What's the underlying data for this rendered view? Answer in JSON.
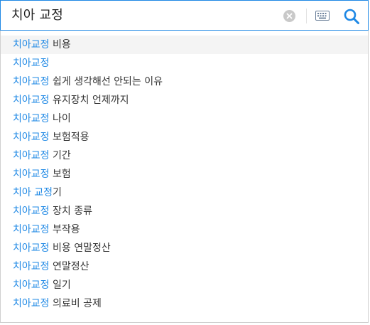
{
  "search": {
    "query": "치아 교정",
    "clear_icon": "clear-circle-icon",
    "keyboard_icon": "keyboard-icon",
    "search_icon": "magnifier-icon"
  },
  "colors": {
    "accent": "#1e88e5",
    "text": "#333333",
    "active_row": "#f4f4f4",
    "clear_button": "#c9c9c9"
  },
  "suggestions": [
    {
      "match": "치아교정",
      "rest": " 비용"
    },
    {
      "match": "치아교정",
      "rest": ""
    },
    {
      "match": "치아교정",
      "rest": " 쉽게 생각해선 안되는 이유"
    },
    {
      "match": "치아교정",
      "rest": " 유지장치 언제까지"
    },
    {
      "match": "치아교정",
      "rest": " 나이"
    },
    {
      "match": "치아교정",
      "rest": " 보험적용"
    },
    {
      "match": "치아교정",
      "rest": " 기간"
    },
    {
      "match": "치아교정",
      "rest": " 보험"
    },
    {
      "match": "치아 교정",
      "rest": "기"
    },
    {
      "match": "치아교정",
      "rest": " 장치 종류"
    },
    {
      "match": "치아교정",
      "rest": " 부작용"
    },
    {
      "match": "치아교정",
      "rest": " 비용 연말정산"
    },
    {
      "match": "치아교정",
      "rest": " 연말정산"
    },
    {
      "match": "치아교정",
      "rest": " 일기"
    },
    {
      "match": "치아교정",
      "rest": " 의료비 공제"
    }
  ]
}
